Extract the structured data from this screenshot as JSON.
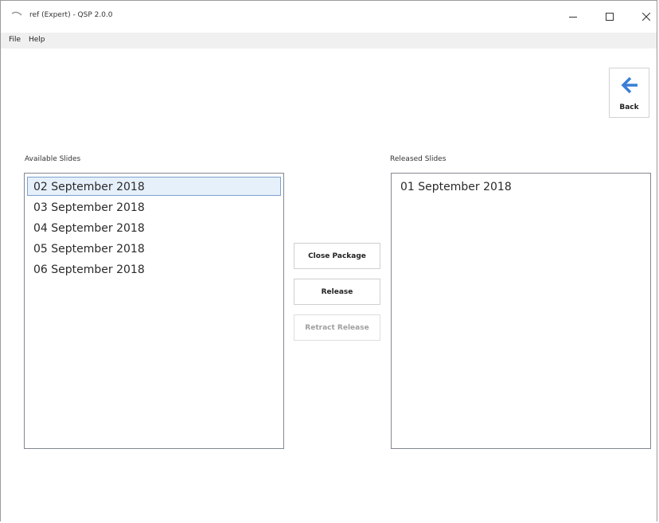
{
  "window": {
    "title": "ref (Expert) - QSP 2.0.0",
    "controls": {
      "minimize_icon": "window-minimize-icon",
      "maximize_icon": "window-maximize-icon",
      "close_icon": "window-close-icon"
    }
  },
  "menu": {
    "items": [
      {
        "label": "File"
      },
      {
        "label": "Help"
      }
    ]
  },
  "back": {
    "label": "Back",
    "icon": "arrow-left-icon",
    "icon_color": "#3a7fd5"
  },
  "available": {
    "label": "Available Slides",
    "items": [
      {
        "text": "02 September 2018",
        "selected": true
      },
      {
        "text": "03 September 2018",
        "selected": false
      },
      {
        "text": "04 September 2018",
        "selected": false
      },
      {
        "text": "05 September 2018",
        "selected": false
      },
      {
        "text": "06 September 2018",
        "selected": false
      }
    ]
  },
  "released": {
    "label": "Released Slides",
    "items": [
      {
        "text": "01 September 2018"
      }
    ]
  },
  "actions": {
    "close_package": "Close Package",
    "release": "Release",
    "retract_release": "Retract Release",
    "retract_enabled": false
  },
  "colors": {
    "selection_bg": "#e6f0fb",
    "selection_border": "#7da2ce",
    "menubar_bg": "#f0f0f0"
  }
}
